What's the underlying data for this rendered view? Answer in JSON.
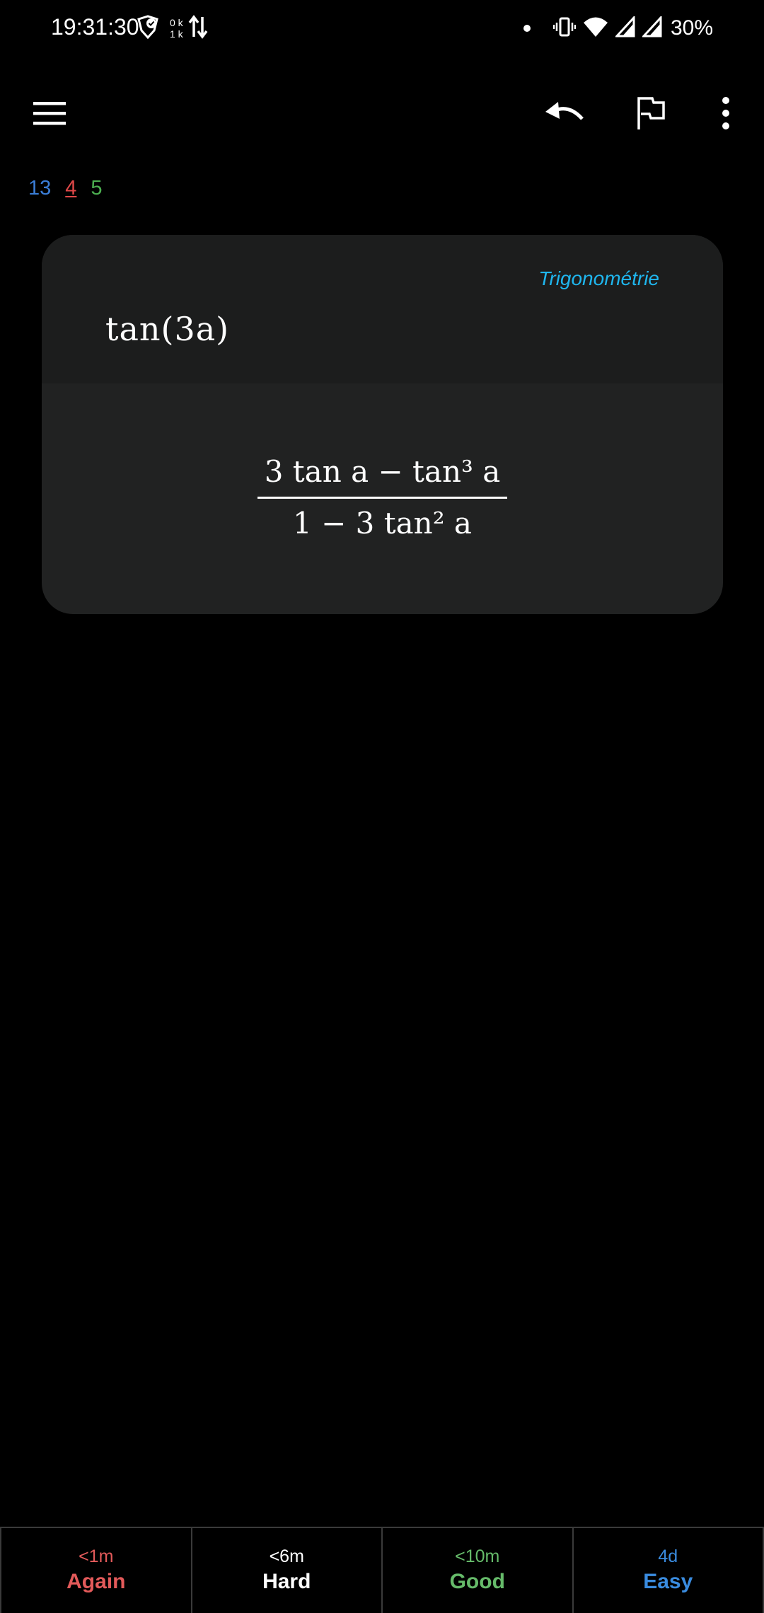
{
  "status_bar": {
    "time": "19:31:30",
    "net_up": "0 k",
    "net_down": "1 k",
    "battery": "30%",
    "icons": [
      "check-shield-icon",
      "data-transfer-icon",
      "notification-dot-icon",
      "vibrate-icon",
      "wifi-icon",
      "signal-icon",
      "signal-icon"
    ]
  },
  "toolbar": {
    "icons": [
      "menu-icon",
      "undo-icon",
      "flag-icon",
      "more-vert-icon"
    ]
  },
  "counts": {
    "new": "13",
    "learning": "4",
    "review": "5"
  },
  "card": {
    "deck_tag": "Trigonométrie",
    "question": "tan(3a)",
    "answer_numerator": "3 tan a − tan³ a",
    "answer_denominator": "1 − 3 tan² a"
  },
  "answer_buttons": [
    {
      "interval": "<1m",
      "label": "Again"
    },
    {
      "interval": "<6m",
      "label": "Hard"
    },
    {
      "interval": "<10m",
      "label": "Good"
    },
    {
      "interval": "4d",
      "label": "Easy"
    }
  ],
  "colors": {
    "again": "#e35a5a",
    "hard": "#ffffff",
    "good": "#66bb6a",
    "easy": "#3a8ce0",
    "deck_tag": "#1fb6ee",
    "count_new": "#3a7dd6",
    "count_learning": "#e04848",
    "count_review": "#4caf50"
  }
}
